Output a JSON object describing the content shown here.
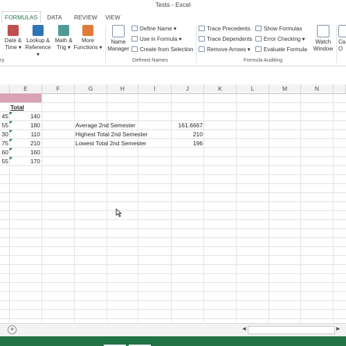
{
  "window": {
    "title": "Tests - Excel"
  },
  "tabs": [
    {
      "label": "FORMULAS",
      "active": true
    },
    {
      "label": "DATA",
      "active": false
    },
    {
      "label": "REVIEW",
      "active": false
    },
    {
      "label": "VIEW",
      "active": false
    }
  ],
  "ribbon": {
    "function_library": {
      "group_label": "ry",
      "buttons": [
        {
          "line1": "Date &",
          "line2": "Time ▾",
          "icon": "date-time-icon",
          "color": "#c0504d"
        },
        {
          "line1": "Lookup &",
          "line2": "Reference ▾",
          "icon": "lookup-icon",
          "color": "#2e75b6"
        },
        {
          "line1": "Math &",
          "line2": "Trig ▾",
          "icon": "math-trig-icon",
          "color": "#4f9a94"
        },
        {
          "line1": "More",
          "line2": "Functions ▾",
          "icon": "more-functions-icon",
          "color": "#e07b39"
        }
      ]
    },
    "defined_names": {
      "group_label": "Defined Names",
      "name_manager": {
        "line1": "Name",
        "line2": "Manager"
      },
      "items": [
        "Define Name ▾",
        "Use in Formula ▾",
        "Create from Selection"
      ]
    },
    "formula_auditing": {
      "group_label": "Formula Auditing",
      "left_items": [
        "Trace Precedents",
        "Trace Dependents",
        "Remove Arrows ▾"
      ],
      "right_items": [
        "Show Formulas",
        "Error Checking ▾",
        "Evaluate Formula"
      ],
      "watch_window": {
        "line1": "Watch",
        "line2": "Window"
      },
      "calc": {
        "line1": "Ca",
        "line2": "O"
      }
    }
  },
  "columns": [
    "E",
    "F",
    "G",
    "H",
    "I",
    "J",
    "K",
    "L",
    "M",
    "N"
  ],
  "sheet": {
    "header_total": "Total",
    "d_values": [
      "45",
      "55",
      "30",
      "75",
      "60",
      "55"
    ],
    "e_values": [
      "140",
      "180",
      "110",
      "210",
      "160",
      "170"
    ],
    "stats": [
      {
        "label": "Average 2nd Semester",
        "value": "161.6667"
      },
      {
        "label": "Highest Total 2nd Semester",
        "value": "210"
      },
      {
        "label": "Lowest Total 2nd Semester",
        "value": "196"
      }
    ]
  },
  "sheet_tabs": {
    "add_icon": "add-sheet-icon",
    "add_symbol": "+",
    "scroll_left_symbol": "◀",
    "scroll_right_symbol": "▶"
  },
  "colors": {
    "accent": "#217346",
    "header_fill": "#d9a3b3",
    "error_triangle": "#1e7b34"
  }
}
